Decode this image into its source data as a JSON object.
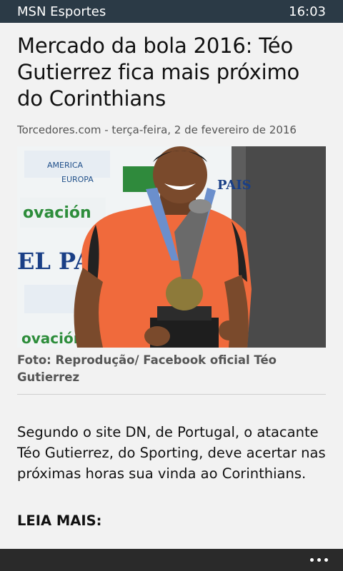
{
  "status_bar": {
    "app_name": "MSN Esportes",
    "time": "16:03"
  },
  "article": {
    "title": "Mercado da bola 2016: Téo Gutierrez fica mais próximo do Corinthians",
    "source_line": "Torcedores.com - terça-feira, 2 de fevereiro de 2016",
    "photo_caption": "Foto: Reprodução/ Facebook oficial Téo Gutierrez",
    "body_paragraph": "Segundo o site DN, de Portugal, o atacante Téo Gutierrez, do Sporting, deve acertar nas próximas horas sua vinda ao Corinthians.",
    "leia_mais": "LEIA MAIS:"
  },
  "photo": {
    "backdrop_lines": [
      "AMERICA",
      "EUROPA",
      "ovación",
      "EL PA",
      "ovación",
      "PAIS"
    ]
  },
  "app_bar": {
    "more_icon": "ellipsis-icon"
  }
}
